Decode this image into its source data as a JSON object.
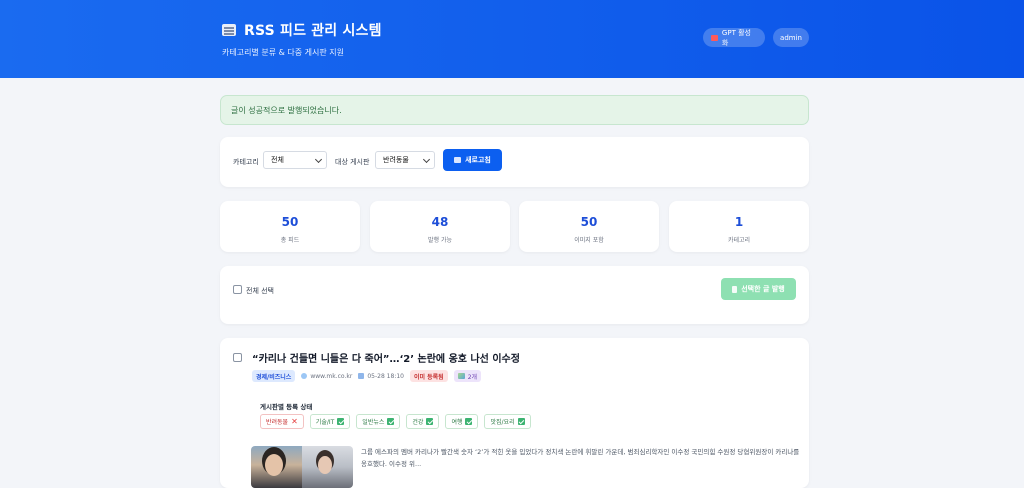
{
  "header": {
    "title": "RSS 피드 관리 시스템",
    "subtitle": "카테고리별 분류 & 다중 게시판 지원",
    "gpt_label": "GPT 활성화",
    "admin_label": "admin"
  },
  "alert": {
    "message": "글이 성공적으로 발행되었습니다."
  },
  "filters": {
    "category_label": "카테고리",
    "category_value": "전체",
    "board_label": "대상 게시판",
    "board_value": "반려동물",
    "refresh_label": "새로고침"
  },
  "stats": [
    {
      "value": "50",
      "label": "총 피드"
    },
    {
      "value": "48",
      "label": "발행 가능"
    },
    {
      "value": "50",
      "label": "이미지 포함"
    },
    {
      "value": "1",
      "label": "카테고리"
    }
  ],
  "selection": {
    "select_all_label": "전체 선택",
    "publish_selected_label": "선택한 글 발행"
  },
  "article": {
    "title": "“카리나 건들면 니들은 다 죽어”…‘2’ 논란에 옹호 나선 이수정",
    "category": "경제/비즈니스",
    "source": "www.mk.co.kr",
    "date": "05-28 18:10",
    "registered_badge": "이미 등록됨",
    "image_count": "2개",
    "board_status_title": "게시판별 등록 상태",
    "boards": [
      {
        "name": "반려동물",
        "status": "fail"
      },
      {
        "name": "기술/IT",
        "status": "ok"
      },
      {
        "name": "일반뉴스",
        "status": "ok"
      },
      {
        "name": "건강",
        "status": "ok"
      },
      {
        "name": "여행",
        "status": "ok"
      },
      {
        "name": "맛집/요리",
        "status": "ok"
      }
    ],
    "summary": "그룹 에스파의 멤버 카리나가 빨간색 숫자 ‘2’가 적힌 옷을 입었다가 정치색 논란에 휘말린 가운데, 범죄심리학자인 이수정 국민의힘 수원정 당협위원장이 카리나를 옹호했다. 이수정 위..."
  }
}
